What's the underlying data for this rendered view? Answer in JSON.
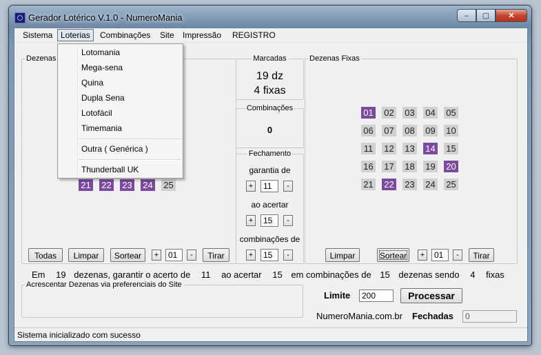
{
  "window": {
    "title": "Gerador Lotérico V.1.0 - NumeroMania",
    "minimize": "‒",
    "maximize": "▢",
    "close": "✕"
  },
  "menu": [
    "Sistema",
    "Loterias",
    "Combinações",
    "Site",
    "Impressão",
    "REGISTRO"
  ],
  "dropdown": {
    "items": [
      "Lotomania",
      "Mega-sena",
      "Quina",
      "Dupla Sena",
      "Lotofácil",
      "Timemania"
    ],
    "other": "Outra ( Genérica )",
    "thunderball": "Thunderball UK"
  },
  "left_panel": {
    "legend": "Dezenas",
    "visible_numbers": [
      {
        "n": "21",
        "sel": true
      },
      {
        "n": "22",
        "sel": true
      },
      {
        "n": "23",
        "sel": true
      },
      {
        "n": "24",
        "sel": true
      },
      {
        "n": "25",
        "sel": false
      }
    ],
    "buttons": {
      "todas": "Todas",
      "limpar": "Limpar",
      "sortear": "Sortear",
      "tirar": "Tirar"
    },
    "stepper_value": "01",
    "plus": "+",
    "minus": "-"
  },
  "marcadas": {
    "legend": "Marcadas",
    "dz": "19 dz",
    "fixas": "4 fixas"
  },
  "combinacoes": {
    "legend": "Combinações",
    "value": "0"
  },
  "fechamento": {
    "legend": "Fechamento",
    "garantia_label": "garantia de",
    "garantia_value": "11",
    "acertar_label": "ao acertar",
    "acertar_value": "15",
    "comb_label": "combinações de",
    "comb_value": "15"
  },
  "fixas_panel": {
    "legend": "Dezenas Fixas",
    "numbers": [
      {
        "n": "01",
        "sel": true
      },
      {
        "n": "02",
        "sel": false
      },
      {
        "n": "03",
        "sel": false
      },
      {
        "n": "04",
        "sel": false
      },
      {
        "n": "05",
        "sel": false
      },
      {
        "n": "06",
        "sel": false
      },
      {
        "n": "07",
        "sel": false
      },
      {
        "n": "08",
        "sel": false
      },
      {
        "n": "09",
        "sel": false
      },
      {
        "n": "10",
        "sel": false
      },
      {
        "n": "11",
        "sel": false
      },
      {
        "n": "12",
        "sel": false
      },
      {
        "n": "13",
        "sel": false
      },
      {
        "n": "14",
        "sel": true
      },
      {
        "n": "15",
        "sel": false
      },
      {
        "n": "16",
        "sel": false
      },
      {
        "n": "17",
        "sel": false
      },
      {
        "n": "18",
        "sel": false
      },
      {
        "n": "19",
        "sel": false
      },
      {
        "n": "20",
        "sel": true
      },
      {
        "n": "21",
        "sel": false
      },
      {
        "n": "22",
        "sel": true
      },
      {
        "n": "23",
        "sel": false
      },
      {
        "n": "24",
        "sel": false
      },
      {
        "n": "25",
        "sel": false
      }
    ],
    "buttons": {
      "limpar": "Limpar",
      "sortear": "Sortear",
      "tirar": "Tirar"
    },
    "stepper_value": "01"
  },
  "summary": [
    "Em",
    "19",
    "dezenas, garantir o acerto de",
    "11",
    "ao acertar",
    "15",
    "em combinações de",
    "15",
    "dezenas sendo",
    "4",
    "fixas"
  ],
  "pref_panel": {
    "legend": "Acrescentar Dezenas via preferenciais do Site"
  },
  "limite": {
    "label": "Limite",
    "value": "200",
    "processar": "Processar"
  },
  "site": "NumeroMania.com.br",
  "fechadas": {
    "label": "Fechadas",
    "value": "0"
  },
  "status": "Sistema inicializado com sucesso",
  "colors": {
    "selected": "#7b4aa0",
    "unselected": "#d0d0d0"
  }
}
